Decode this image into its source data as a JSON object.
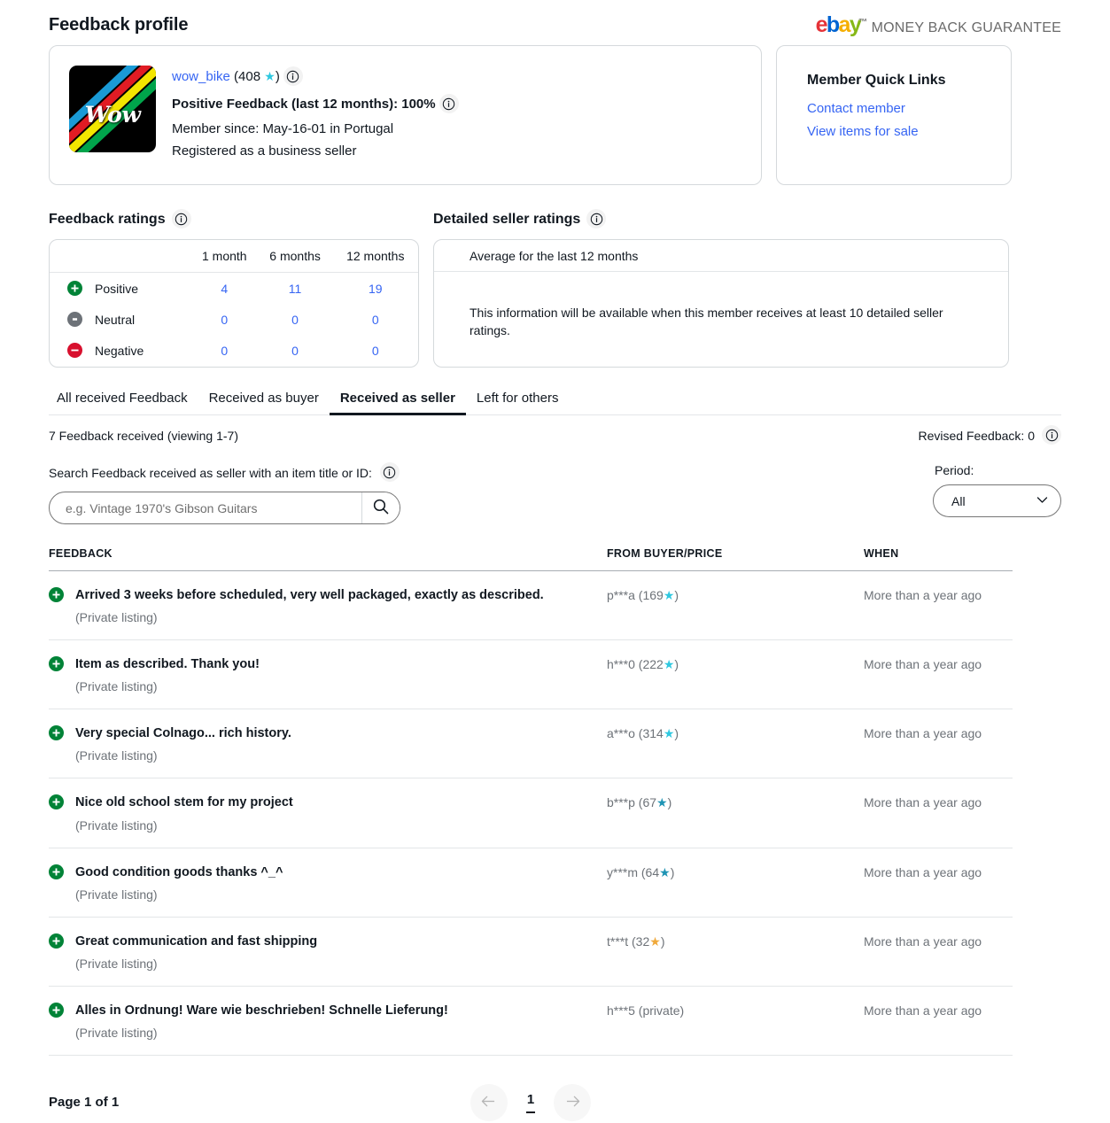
{
  "header": {
    "page_title": "Feedback profile",
    "brand": {
      "e": "e",
      "b": "b",
      "a": "a",
      "y": "y",
      "tm": "™"
    },
    "mbg_text": "MONEY BACK GUARANTEE"
  },
  "profile": {
    "avatar_text": "Wow",
    "username": "wow_bike",
    "score_open": "(",
    "score": "408",
    "star": "★",
    "score_close": ")",
    "positive_feedback": "Positive Feedback (last 12 months): 100%",
    "member_since": "Member since: May-16-01 in Portugal",
    "registered": "Registered as a business seller"
  },
  "quick_links": {
    "title": "Member Quick Links",
    "links": [
      "Contact member",
      "View items for sale"
    ]
  },
  "feedback_ratings": {
    "title": "Feedback ratings",
    "columns": [
      "1 month",
      "6 months",
      "12 months"
    ],
    "rows": [
      {
        "label": "Positive",
        "type": "pos",
        "values": [
          "4",
          "11",
          "19"
        ]
      },
      {
        "label": "Neutral",
        "type": "neu",
        "values": [
          "0",
          "0",
          "0"
        ]
      },
      {
        "label": "Negative",
        "type": "neg",
        "values": [
          "0",
          "0",
          "0"
        ]
      }
    ]
  },
  "detailed_seller_ratings": {
    "title": "Detailed seller ratings",
    "subhead": "Average for the last 12 months",
    "message": "This information will be available when this member receives at least 10 detailed seller ratings."
  },
  "tabs": [
    {
      "label": "All received Feedback",
      "active": false
    },
    {
      "label": "Received as buyer",
      "active": false
    },
    {
      "label": "Received as seller",
      "active": true
    },
    {
      "label": "Left for others",
      "active": false
    }
  ],
  "summary": {
    "count_text": "7 Feedback received (viewing 1-7)",
    "revised_text": "Revised Feedback: 0"
  },
  "search": {
    "label": "Search Feedback received as seller with an item title or ID:",
    "placeholder": "e.g. Vintage 1970's Gibson Guitars",
    "value": ""
  },
  "period": {
    "label": "Period:",
    "selected": "All",
    "options": [
      "All"
    ]
  },
  "table": {
    "headers": {
      "feedback": "FEEDBACK",
      "buyer": "FROM BUYER/PRICE",
      "when": "WHEN"
    },
    "rows": [
      {
        "type": "pos",
        "comment": "Arrived 3 weeks before scheduled, very well packaged, exactly as described.",
        "listing": "(Private listing)",
        "buyer": "p***a (169",
        "buyer_star": "★",
        "buyer_star_color": "turq",
        "buyer_suffix": ")",
        "when": "More than a year ago"
      },
      {
        "type": "pos",
        "comment": "Item as described. Thank you!",
        "listing": "(Private listing)",
        "buyer": "h***0 (222",
        "buyer_star": "★",
        "buyer_star_color": "turq",
        "buyer_suffix": ")",
        "when": "More than a year ago"
      },
      {
        "type": "pos",
        "comment": "Very special Colnago... rich history.",
        "listing": "(Private listing)",
        "buyer": "a***o (314",
        "buyer_star": "★",
        "buyer_star_color": "turq",
        "buyer_suffix": ")",
        "when": "More than a year ago"
      },
      {
        "type": "pos",
        "comment": "Nice old school stem for my project",
        "listing": "(Private listing)",
        "buyer": "b***p (67",
        "buyer_star": "★",
        "buyer_star_color": "teal",
        "buyer_suffix": ")",
        "when": "More than a year ago"
      },
      {
        "type": "pos",
        "comment": "Good condition goods thanks ^_^",
        "listing": "(Private listing)",
        "buyer": "y***m (64",
        "buyer_star": "★",
        "buyer_star_color": "teal",
        "buyer_suffix": ")",
        "when": "More than a year ago"
      },
      {
        "type": "pos",
        "comment": "Great communication and fast shipping",
        "listing": "(Private listing)",
        "buyer": "t***t (32",
        "buyer_star": "★",
        "buyer_star_color": "gold",
        "buyer_suffix": ")",
        "when": "More than a year ago"
      },
      {
        "type": "pos",
        "comment": "Alles in Ordnung! Ware wie beschrieben! Schnelle Lieferung!",
        "listing": "(Private listing)",
        "buyer": "h***5 (private)",
        "buyer_star": "",
        "buyer_star_color": "none",
        "buyer_suffix": "",
        "when": "More than a year ago"
      }
    ]
  },
  "pagination": {
    "page_of": "Page 1 of 1",
    "prev": "←",
    "current": "1",
    "next": "→"
  },
  "colors": {
    "link": "#3665f3",
    "positive": "#018337",
    "neutral": "#6d7278",
    "negative": "#d8102e",
    "star_turquoise": "#2fc8e0",
    "star_teal": "#1e94b4",
    "star_gold": "#f0a93b"
  }
}
